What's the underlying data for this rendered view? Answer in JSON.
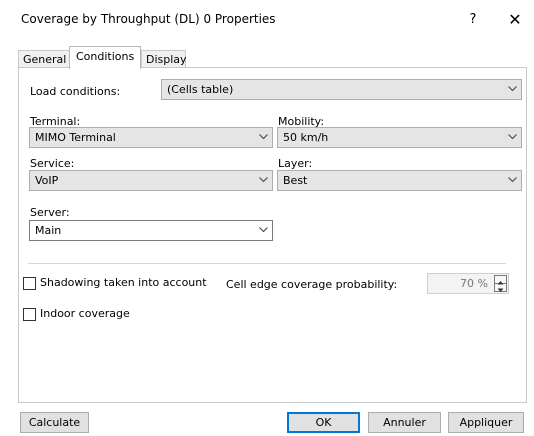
{
  "window": {
    "title": "Coverage by Throughput (DL) 0 Properties",
    "help": "?",
    "close": "✕"
  },
  "tabs": [
    {
      "label": "General",
      "active": false
    },
    {
      "label": "Conditions",
      "active": true
    },
    {
      "label": "Display",
      "active": false
    }
  ],
  "conditions": {
    "load_conditions": {
      "label": "Load conditions:",
      "value": "(Cells table)"
    },
    "terminal": {
      "label": "Terminal:",
      "value": "MIMO Terminal"
    },
    "mobility": {
      "label": "Mobility:",
      "value": "50 km/h"
    },
    "service": {
      "label": "Service:",
      "value": "VoIP"
    },
    "layer": {
      "label": "Layer:",
      "value": "Best"
    },
    "server": {
      "label": "Server:",
      "value": "Main"
    },
    "shadowing": {
      "label": "Shadowing taken into account",
      "checked": false
    },
    "cell_edge": {
      "label": "Cell edge coverage probability:",
      "value": "70 %"
    },
    "indoor": {
      "label": "Indoor coverage",
      "checked": false
    }
  },
  "buttons": {
    "calculate": "Calculate",
    "ok": "OK",
    "cancel": "Annuler",
    "apply": "Appliquer"
  },
  "icons": {
    "dropdown": "chevron-down-icon",
    "spin_up": "spin-up-icon",
    "spin_down": "spin-down-icon"
  },
  "colors": {
    "default_button_border": "#0078d7",
    "combo_gray": "#e5e5e5",
    "button_gray": "#e1e1e1"
  }
}
